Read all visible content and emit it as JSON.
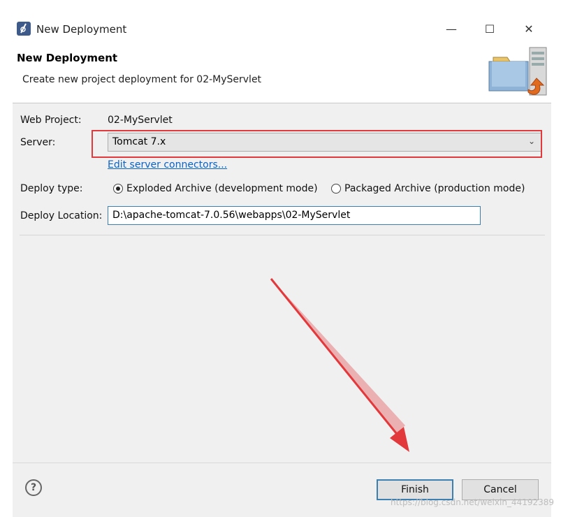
{
  "window": {
    "title": "New Deployment",
    "controls": {
      "minimize": "—",
      "maximize": "☐",
      "close": "✕"
    }
  },
  "header": {
    "title": "New Deployment",
    "description": "Create new project deployment for 02-MyServlet"
  },
  "form": {
    "web_project_label": "Web Project:",
    "web_project_value": "02-MyServlet",
    "server_label": "Server:",
    "server_value": "Tomcat  7.x",
    "edit_connectors_link": "Edit server connectors...",
    "deploy_type_label": "Deploy type:",
    "deploy_type_options": [
      {
        "label": "Exploded Archive (development mode)",
        "selected": true
      },
      {
        "label": "Packaged Archive (production mode)",
        "selected": false
      }
    ],
    "deploy_location_label": "Deploy Location:",
    "deploy_location_value": "D:\\apache-tomcat-7.0.56\\webapps\\02-MyServlet"
  },
  "footer": {
    "help": "?",
    "finish_label": "Finish",
    "cancel_label": "Cancel"
  },
  "watermark": "https://blog.csdn.net/weixin_44192389",
  "colors": {
    "highlight": "#e2393c",
    "link": "#0b62c8",
    "accent_border": "#3c7fb1"
  }
}
